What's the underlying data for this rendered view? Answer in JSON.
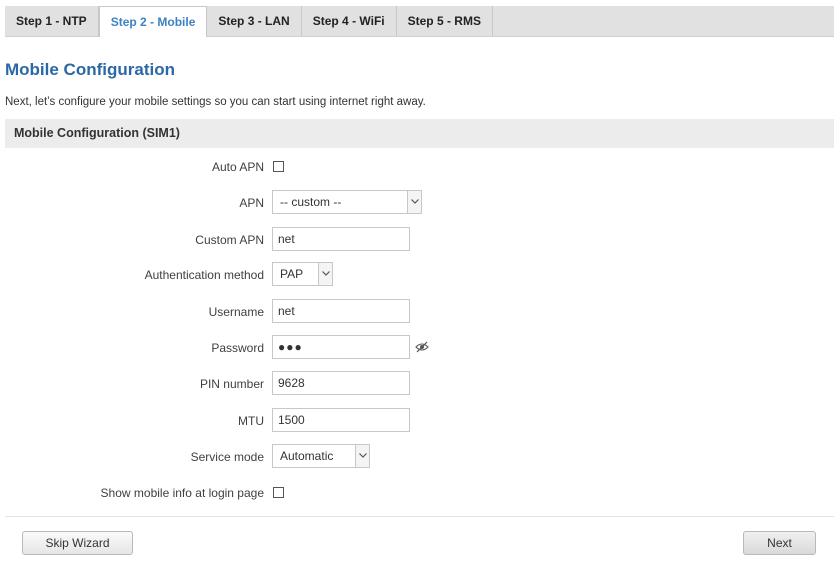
{
  "tabs": [
    {
      "label": "Step 1 - NTP",
      "active": false
    },
    {
      "label": "Step 2 - Mobile",
      "active": true
    },
    {
      "label": "Step 3 - LAN",
      "active": false
    },
    {
      "label": "Step 4 - WiFi",
      "active": false
    },
    {
      "label": "Step 5 - RMS",
      "active": false
    }
  ],
  "colors": {
    "accent": "#3b82c4",
    "title": "#2a68a6",
    "section_bg": "#ececec",
    "tabbar_bg": "#e1e1e1"
  },
  "page": {
    "title": "Mobile Configuration",
    "description": "Next, let’s configure your mobile settings so you can start using internet right away."
  },
  "section": {
    "title": "Mobile Configuration (SIM1)"
  },
  "form": {
    "auto_apn": {
      "label": "Auto APN",
      "checked": false
    },
    "apn": {
      "label": "APN",
      "value": "-- custom --"
    },
    "custom_apn": {
      "label": "Custom APN",
      "value": "net"
    },
    "auth_method": {
      "label": "Authentication method",
      "value": "PAP"
    },
    "username": {
      "label": "Username",
      "value": "net"
    },
    "password": {
      "label": "Password",
      "value": "●●●",
      "toggle_icon": "eye-slash-icon"
    },
    "pin": {
      "label": "PIN number",
      "value": "9628"
    },
    "mtu": {
      "label": "MTU",
      "value": "1500"
    },
    "service_mode": {
      "label": "Service mode",
      "value": "Automatic"
    },
    "show_info": {
      "label": "Show mobile info at login page",
      "checked": false
    }
  },
  "buttons": {
    "skip": "Skip Wizard",
    "next": "Next"
  }
}
